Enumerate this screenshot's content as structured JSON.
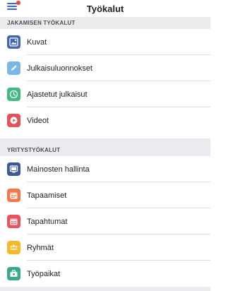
{
  "header": {
    "title": "Työkalut"
  },
  "sections": [
    {
      "title": "JAKAMISEN TYÖKALUT",
      "items": [
        {
          "label": "Kuvat",
          "icon": "photos-icon",
          "color": "#4267b2"
        },
        {
          "label": "Julkaisuluonnokset",
          "icon": "pencil-icon",
          "color": "#7bb7e4"
        },
        {
          "label": "Ajastetut julkaisut",
          "icon": "clock-icon",
          "color": "#42b883"
        },
        {
          "label": "Videot",
          "icon": "video-play-icon",
          "color": "#e4515a"
        }
      ]
    },
    {
      "title": "YRITYSTYÖKALUT",
      "items": [
        {
          "label": "Mainosten hallinta",
          "icon": "ads-manager-icon",
          "color": "#3b5998"
        },
        {
          "label": "Tapaamiset",
          "icon": "appointments-icon",
          "color": "#f2784b"
        },
        {
          "label": "Tapahtumat",
          "icon": "calendar-icon",
          "color": "#e9535f"
        },
        {
          "label": "Ryhmät",
          "icon": "groups-icon",
          "color": "#f7b928"
        },
        {
          "label": "Työpaikat",
          "icon": "briefcase-icon",
          "color": "#3aa990"
        }
      ]
    }
  ]
}
